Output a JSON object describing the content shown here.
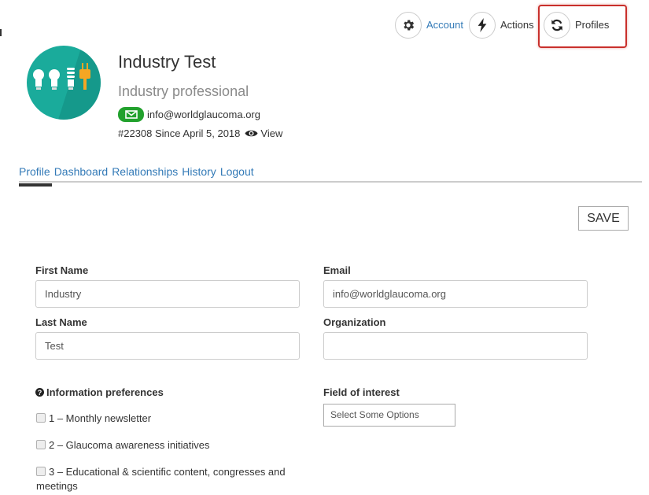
{
  "top_actions": {
    "account_label": "Account",
    "actions_label": "Actions",
    "profiles_label": "Profiles",
    "icons": [
      "gear-icon",
      "bolt-icon",
      "refresh-icon"
    ]
  },
  "profile": {
    "name": "Industry Test",
    "role": "Industry professional",
    "email": "info@worldglaucoma.org",
    "member_info": "#22308 Since April 5, 2018",
    "view_label": "View"
  },
  "tabs": [
    {
      "label": "Profile",
      "active": true
    },
    {
      "label": "Dashboard"
    },
    {
      "label": "Relationships"
    },
    {
      "label": "History"
    },
    {
      "label": "Logout"
    }
  ],
  "save_label": "SAVE",
  "form": {
    "first_name": {
      "label": "First Name",
      "value": "Industry"
    },
    "last_name": {
      "label": "Last Name",
      "value": "Test"
    },
    "email": {
      "label": "Email",
      "value": "info@worldglaucoma.org"
    },
    "organization": {
      "label": "Organization",
      "value": ""
    },
    "preferences": {
      "label": "Information preferences",
      "options": [
        {
          "label": "1 – Monthly newsletter",
          "checked": false
        },
        {
          "label": "2 – Glaucoma awareness initiatives",
          "checked": false
        },
        {
          "label": "3 – Educational & scientific content, congresses and meetings",
          "checked": false
        }
      ]
    },
    "field_of_interest": {
      "label": "Field of interest",
      "placeholder": "Select Some Options"
    }
  },
  "colors": {
    "link": "#337ab7",
    "highlight_border": "#c9302c",
    "avatar_bg": "#1aab9b",
    "mail_badge": "#22a12d",
    "accent_orange": "#f5a623"
  }
}
